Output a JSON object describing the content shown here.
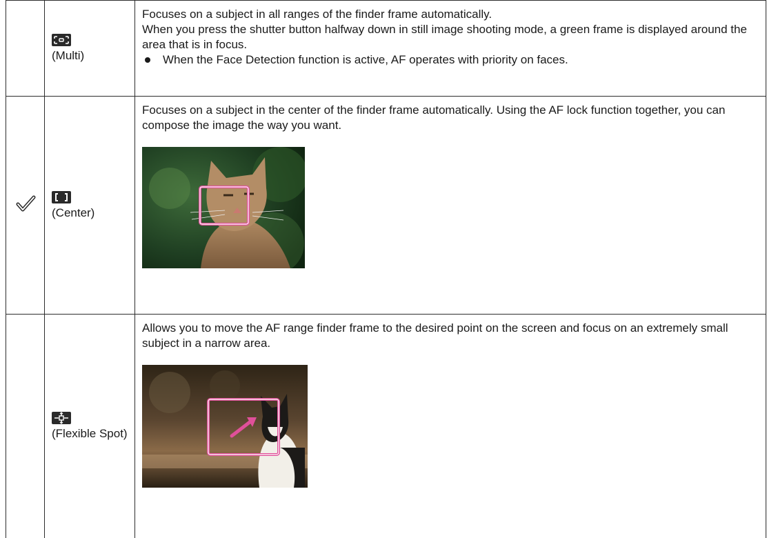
{
  "rows": [
    {
      "mode_icon": "af-multi-icon",
      "mode_label": "(Multi)",
      "selected": false,
      "lines": [
        "Focuses on a subject in all ranges of the finder frame automatically.",
        "When you press the shutter button halfway down in still image shooting mode, a green frame is displayed around the area that is in focus."
      ],
      "bullet": "When the Face Detection function is active, AF operates with priority on faces."
    },
    {
      "mode_icon": "af-center-icon",
      "mode_label": "(Center)",
      "selected": true,
      "check_icon": "checkmark-icon",
      "description": "Focuses on a subject in the center of the finder frame automatically. Using the AF lock function together, you can compose the image the way you want.",
      "image": "cat-center-focus-photo"
    },
    {
      "mode_icon": "af-flexible-spot-icon",
      "mode_label": "(Flexible Spot)",
      "selected": false,
      "description": "Allows you to move the AF range finder frame to the desired point on the screen and focus on an extremely small subject in a narrow area.",
      "image": "cat-flexible-spot-photo"
    }
  ],
  "colors": {
    "focus_frame": "#e0509a",
    "border": "#2b2b2b",
    "text": "#1a1a1a"
  }
}
